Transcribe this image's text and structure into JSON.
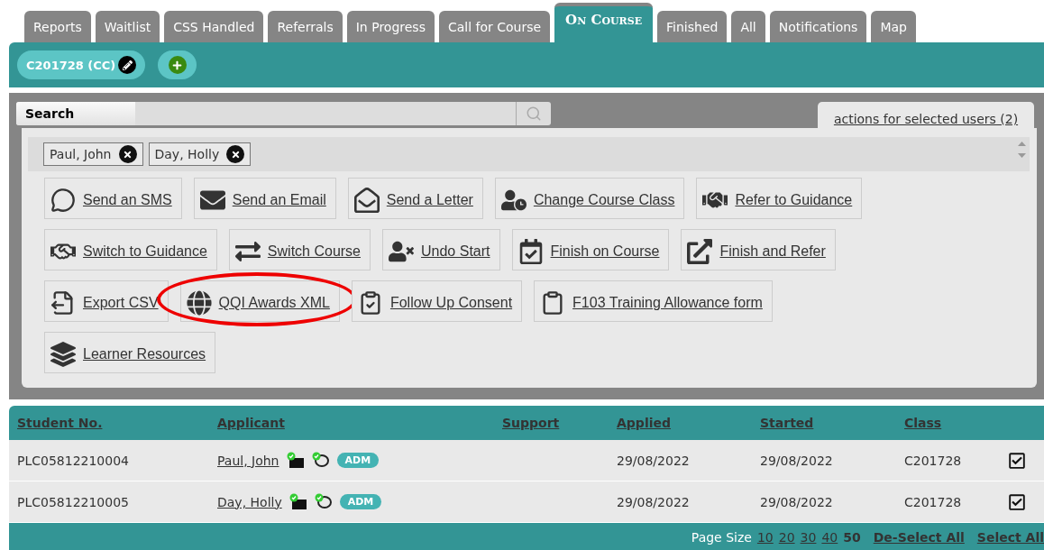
{
  "tabs": [
    {
      "label": "Reports",
      "selected": false
    },
    {
      "label": "Waitlist",
      "selected": false
    },
    {
      "label": "CSS Handled",
      "selected": false
    },
    {
      "label": "Referrals",
      "selected": false
    },
    {
      "label": "In Progress",
      "selected": false
    },
    {
      "label": "Call for Course",
      "selected": false
    },
    {
      "label": "On Course",
      "selected": true
    },
    {
      "label": "Finished",
      "selected": false
    },
    {
      "label": "All",
      "selected": false
    },
    {
      "label": "Notifications",
      "selected": false
    },
    {
      "label": "Map",
      "selected": false
    }
  ],
  "class_chip": {
    "label": "C201728 (CC)"
  },
  "search": {
    "label": "Search"
  },
  "actions_tab": {
    "label": "actions for selected users (2)"
  },
  "selected_users": [
    {
      "name": "Paul, John"
    },
    {
      "name": "Day, Holly"
    }
  ],
  "action_rows": [
    [
      {
        "label": "Send an SMS",
        "circled": false
      },
      {
        "label": "Send an Email",
        "circled": false
      },
      {
        "label": "Send a Letter",
        "circled": false
      },
      {
        "label": "Change Course Class",
        "circled": false
      },
      {
        "label": "Refer to Guidance",
        "circled": false
      }
    ],
    [
      {
        "label": "Switch to Guidance",
        "circled": false
      },
      {
        "label": "Switch Course",
        "circled": false
      },
      {
        "label": "Undo Start",
        "circled": false
      },
      {
        "label": "Finish on Course",
        "circled": false
      },
      {
        "label": "Finish and Refer",
        "circled": false
      }
    ],
    [
      {
        "label": "Export CSV",
        "circled": false
      },
      {
        "label": "QQI Awards XML",
        "circled": true
      },
      {
        "label": "Follow Up Consent",
        "circled": false
      },
      {
        "label": "F103 Training Allowance form",
        "circled": false
      }
    ],
    [
      {
        "label": "Learner Resources",
        "circled": false
      }
    ]
  ],
  "table": {
    "columns": [
      "Student No.",
      "Applicant",
      "Support",
      "Applied",
      "Started",
      "Class"
    ],
    "rows": [
      {
        "student_no": "PLC05812210004",
        "applicant": "Paul, John",
        "badge": "ADM",
        "applied": "29/08/2022",
        "started": "29/08/2022",
        "class": "C201728",
        "checked": true
      },
      {
        "student_no": "PLC05812210005",
        "applicant": "Day, Holly",
        "badge": "ADM",
        "applied": "29/08/2022",
        "started": "29/08/2022",
        "class": "C201728",
        "checked": true
      }
    ]
  },
  "footer": {
    "page_size_label": "Page Size",
    "page_sizes": [
      {
        "label": "10",
        "selected": false
      },
      {
        "label": "20",
        "selected": false
      },
      {
        "label": "30",
        "selected": false
      },
      {
        "label": "40",
        "selected": false
      },
      {
        "label": "50",
        "selected": true
      }
    ],
    "links": [
      "De-Select All",
      "Select All"
    ]
  }
}
